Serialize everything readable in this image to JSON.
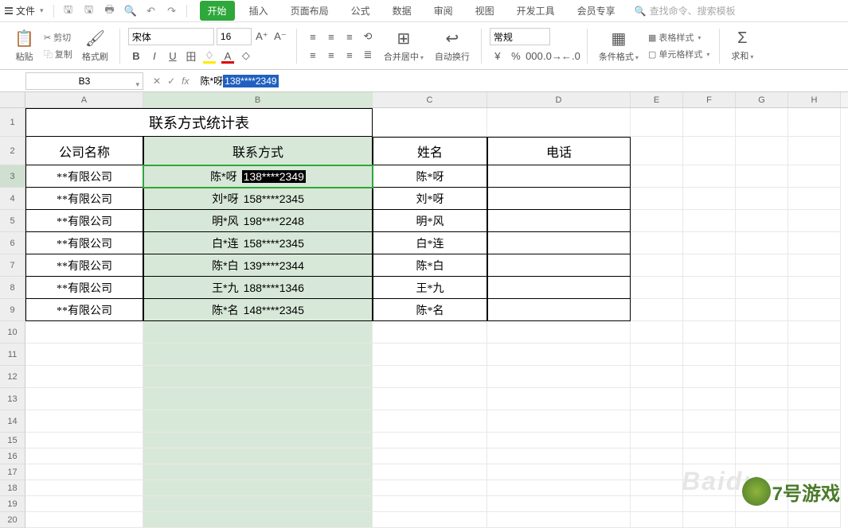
{
  "menu": {
    "file": "文件",
    "tabs": [
      "开始",
      "插入",
      "页面布局",
      "公式",
      "数据",
      "审阅",
      "视图",
      "开发工具",
      "会员专享"
    ],
    "active_tab": 0,
    "search_placeholder": "查找命令、搜索模板"
  },
  "ribbon": {
    "paste": "粘贴",
    "cut": "剪切",
    "copy": "复制",
    "format_painter": "格式刷",
    "font_name": "宋体",
    "font_size": "16",
    "merge_center": "合并居中",
    "wrap_text": "自动换行",
    "number_format": "常规",
    "cond_format": "条件格式",
    "table_style": "表格样式",
    "cell_style": "单元格样式",
    "sum": "求和"
  },
  "formula_bar": {
    "name_box": "B3",
    "text_plain": "陈*呀 ",
    "text_selected": "138****2349"
  },
  "columns": [
    "A",
    "B",
    "C",
    "D",
    "E",
    "F",
    "G",
    "H"
  ],
  "table": {
    "title": "联系方式统计表",
    "headers": {
      "A": "公司名称",
      "B": "联系方式",
      "C": "姓名",
      "D": "电话"
    },
    "rows": [
      {
        "company": "**有限公司",
        "contact_name": "陈*呀",
        "contact_phone": "138****2349",
        "name": "陈*呀",
        "phone": "",
        "editing": true
      },
      {
        "company": "**有限公司",
        "contact_name": "刘*呀",
        "contact_phone": "158****2345",
        "name": "刘*呀",
        "phone": ""
      },
      {
        "company": "**有限公司",
        "contact_name": "明*风",
        "contact_phone": "198****2248",
        "name": "明*风",
        "phone": ""
      },
      {
        "company": "**有限公司",
        "contact_name": "白*连",
        "contact_phone": "158****2345",
        "name": "白*连",
        "phone": ""
      },
      {
        "company": "**有限公司",
        "contact_name": "陈*白",
        "contact_phone": "139****2344",
        "name": "陈*白",
        "phone": ""
      },
      {
        "company": "**有限公司",
        "contact_name": "王*九",
        "contact_phone": "188****1346",
        "name": "王*九",
        "phone": ""
      },
      {
        "company": "**有限公司",
        "contact_name": "陈*名",
        "contact_phone": "148****2345",
        "name": "陈*名",
        "phone": ""
      }
    ]
  },
  "row_labels": [
    "1",
    "2",
    "3",
    "4",
    "5",
    "6",
    "7",
    "8",
    "9",
    "10",
    "11",
    "12",
    "13",
    "14",
    "15",
    "16",
    "17",
    "18",
    "19",
    "20"
  ],
  "watermark1": "Baidu",
  "watermark2": "7号游戏"
}
